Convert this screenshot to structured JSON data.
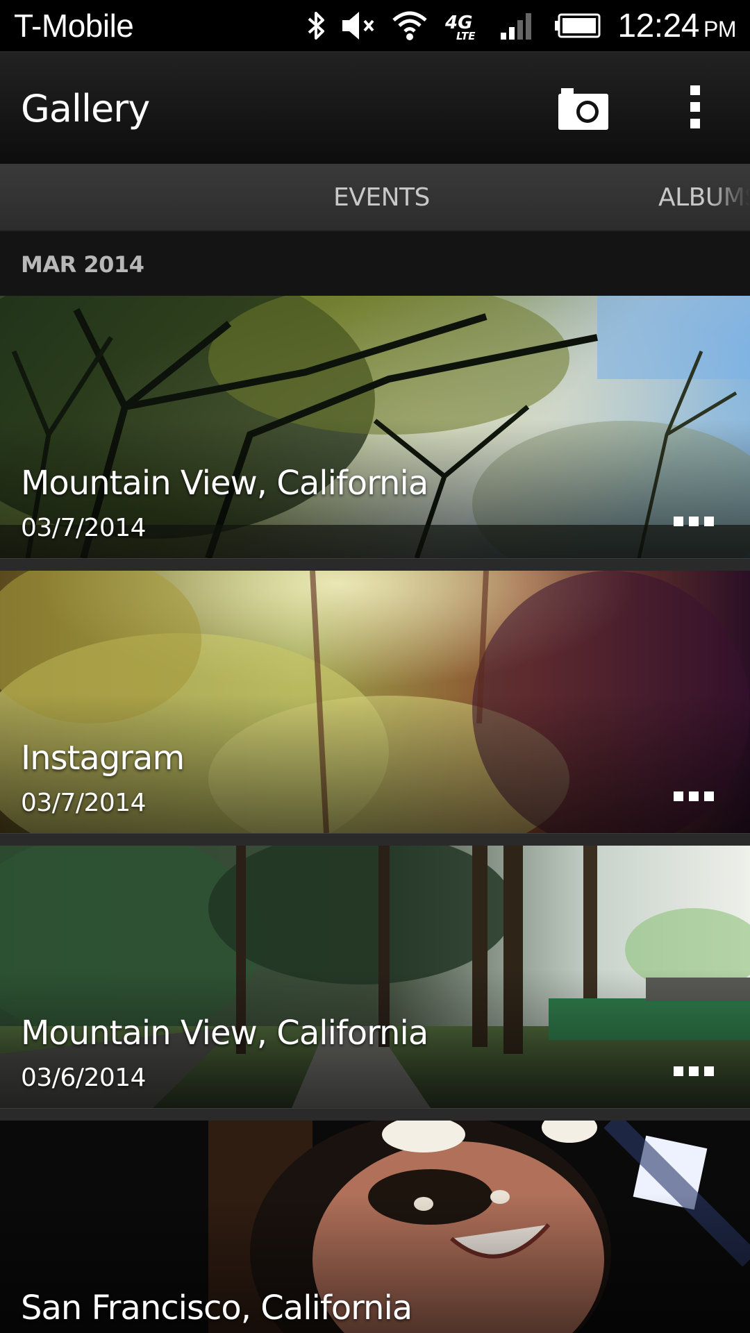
{
  "status_bar": {
    "carrier": "T-Mobile",
    "network": "4G LTE",
    "time": "12:24",
    "ampm": "PM",
    "icons": [
      "bluetooth-icon",
      "mute-icon",
      "wifi-icon",
      "4g-lte-icon",
      "signal-icon",
      "battery-icon"
    ]
  },
  "action_bar": {
    "title": "Gallery",
    "camera_icon": "camera-icon",
    "overflow_icon": "overflow-menu-icon"
  },
  "tabs": [
    {
      "label": "EVENTS",
      "selected": true
    },
    {
      "label": "ALBUMS",
      "selected": false
    }
  ],
  "section": {
    "label": "MAR 2014"
  },
  "events": [
    {
      "title": "Mountain View, California",
      "date": "03/7/2014"
    },
    {
      "title": "Instagram",
      "date": "03/7/2014"
    },
    {
      "title": "Mountain View, California",
      "date": "03/6/2014"
    },
    {
      "title": "San Francisco, California",
      "date": ""
    }
  ],
  "colors": {
    "background": "#121212",
    "action_bar": "#1a1a1a",
    "tab_bar": "#333333",
    "text_primary": "#ffffff",
    "text_secondary": "#c8c8c8"
  }
}
